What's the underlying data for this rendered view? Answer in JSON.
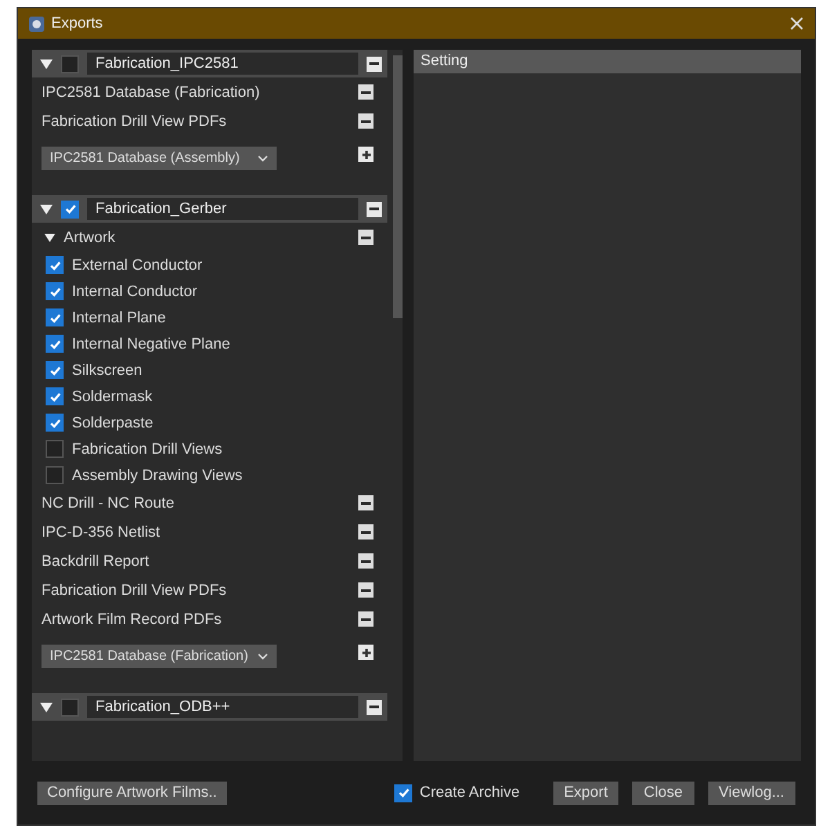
{
  "window": {
    "title": "Exports"
  },
  "groups": [
    {
      "name": "Fabrication_IPC2581",
      "checked": false,
      "expanded": true,
      "items": [
        {
          "kind": "output",
          "label": "IPC2581 Database (Fabrication)"
        },
        {
          "kind": "output",
          "label": "Fabrication Drill View PDFs"
        }
      ],
      "dropdown": {
        "value": "IPC2581 Database (Assembly)"
      }
    },
    {
      "name": "Fabrication_Gerber",
      "checked": true,
      "expanded": true,
      "items": [
        {
          "kind": "section",
          "label": "Artwork",
          "expanded": true,
          "children": [
            {
              "label": "External Conductor",
              "checked": true
            },
            {
              "label": "Internal Conductor",
              "checked": true
            },
            {
              "label": "Internal Plane",
              "checked": true
            },
            {
              "label": "Internal Negative Plane",
              "checked": true
            },
            {
              "label": "Silkscreen",
              "checked": true
            },
            {
              "label": "Soldermask",
              "checked": true
            },
            {
              "label": "Solderpaste",
              "checked": true
            },
            {
              "label": "Fabrication Drill Views",
              "checked": false
            },
            {
              "label": "Assembly Drawing Views",
              "checked": false
            }
          ]
        },
        {
          "kind": "output",
          "label": "NC Drill - NC Route"
        },
        {
          "kind": "output",
          "label": "IPC-D-356 Netlist"
        },
        {
          "kind": "output",
          "label": "Backdrill Report"
        },
        {
          "kind": "output",
          "label": "Fabrication Drill View PDFs"
        },
        {
          "kind": "output",
          "label": "Artwork Film Record PDFs"
        }
      ],
      "dropdown": {
        "value": "IPC2581 Database (Fabrication)"
      }
    },
    {
      "name": "Fabrication_ODB++",
      "checked": false,
      "expanded": true
    }
  ],
  "settings": {
    "header": "Setting"
  },
  "footer": {
    "configure_button": "Configure Artwork Films..",
    "create_archive": {
      "label": "Create Archive",
      "checked": true
    },
    "buttons": [
      "Export",
      "Close",
      "Viewlog..."
    ]
  }
}
